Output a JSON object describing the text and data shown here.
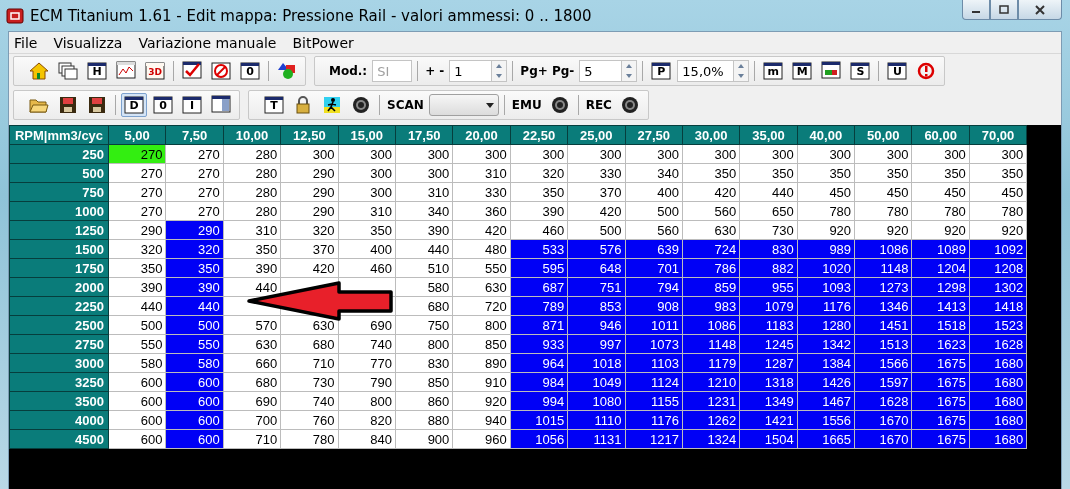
{
  "window": {
    "title": "ECM Titanium 1.61 - Edit mappa: Pressione Rail - valori ammessi: 0 .. 1800"
  },
  "menu": [
    "File",
    "Visualizza",
    "Variazione manuale",
    "BitPower"
  ],
  "toolbars": [
    {
      "groups": [
        {
          "items": [
            {
              "kind": "house",
              "pressed": false
            },
            {
              "kind": "windows",
              "pressed": false
            },
            {
              "kind": "letter",
              "glyph": "H",
              "pressed": false
            },
            {
              "kind": "chart",
              "pressed": false
            },
            {
              "kind": "redletter",
              "glyph": "3D",
              "pressed": false
            },
            {
              "kind": "sep"
            },
            {
              "kind": "check",
              "pressed": false
            },
            {
              "kind": "stop",
              "pressed": false
            },
            {
              "kind": "letter",
              "glyph": "0",
              "pressed": false
            },
            {
              "kind": "sep"
            },
            {
              "kind": "shapes",
              "pressed": false
            }
          ]
        },
        {
          "items": [
            {
              "kind": "label",
              "text": "Mod.:"
            },
            {
              "kind": "field",
              "value": "SI",
              "disabled": true
            },
            {
              "kind": "sep"
            },
            {
              "kind": "label",
              "text": "+ -"
            },
            {
              "kind": "spin",
              "value": "1"
            },
            {
              "kind": "sep"
            },
            {
              "kind": "label",
              "text": "Pg+ Pg-"
            },
            {
              "kind": "spin",
              "value": "5"
            },
            {
              "kind": "sep"
            },
            {
              "kind": "letter",
              "glyph": "P",
              "pressed": false
            },
            {
              "kind": "spin",
              "value": "15,0%"
            },
            {
              "kind": "sep"
            },
            {
              "kind": "letter",
              "glyph": "m",
              "pressed": false
            },
            {
              "kind": "letter",
              "glyph": "M",
              "pressed": false
            },
            {
              "kind": "bars",
              "pressed": false
            },
            {
              "kind": "letter",
              "glyph": "S",
              "pressed": false
            },
            {
              "kind": "sep"
            },
            {
              "kind": "letter",
              "glyph": "U",
              "pressed": false
            },
            {
              "kind": "alert",
              "pressed": false
            }
          ]
        }
      ]
    },
    {
      "groups": [
        {
          "items": [
            {
              "kind": "folder",
              "pressed": false
            },
            {
              "kind": "floppy",
              "pressed": false
            },
            {
              "kind": "floppy",
              "pressed": false
            },
            {
              "kind": "sep"
            },
            {
              "kind": "letter",
              "glyph": "D",
              "pressed": true
            },
            {
              "kind": "letter",
              "glyph": "0",
              "pressed": false
            },
            {
              "kind": "letter",
              "glyph": "I",
              "pressed": false
            },
            {
              "kind": "panel",
              "pressed": false
            }
          ]
        },
        {
          "items": [
            {
              "kind": "letter",
              "glyph": "T",
              "pressed": false
            },
            {
              "kind": "lock",
              "pressed": false
            },
            {
              "kind": "runner",
              "pressed": false
            },
            {
              "kind": "record",
              "pressed": false
            },
            {
              "kind": "sep"
            },
            {
              "kind": "label",
              "text": "SCAN"
            },
            {
              "kind": "combo"
            },
            {
              "kind": "sep"
            },
            {
              "kind": "label",
              "text": "EMU"
            },
            {
              "kind": "record",
              "pressed": false
            },
            {
              "kind": "sep"
            },
            {
              "kind": "label",
              "text": "REC"
            },
            {
              "kind": "record",
              "pressed": false
            }
          ]
        }
      ]
    }
  ],
  "table": {
    "corner": "RPM|mm3/cyc",
    "columns": [
      "5,00",
      "7,50",
      "10,00",
      "12,50",
      "15,00",
      "17,50",
      "20,00",
      "22,50",
      "25,00",
      "27,50",
      "30,00",
      "35,00",
      "40,00",
      "50,00",
      "60,00",
      "70,00"
    ],
    "rows": [
      {
        "rpm": "250",
        "cells": [
          {
            "text": "270",
            "selected": false,
            "focused": true
          },
          {
            "text": "270",
            "selected": false,
            "focused": false
          },
          {
            "text": "280",
            "selected": false,
            "focused": false
          },
          {
            "text": "300",
            "selected": false,
            "focused": false
          },
          {
            "text": "300",
            "selected": false,
            "focused": false
          },
          {
            "text": "300",
            "selected": false,
            "focused": false
          },
          {
            "text": "300",
            "selected": false,
            "focused": false
          },
          {
            "text": "300",
            "selected": false,
            "focused": false
          },
          {
            "text": "300",
            "selected": false,
            "focused": false
          },
          {
            "text": "300",
            "selected": false,
            "focused": false
          },
          {
            "text": "300",
            "selected": false,
            "focused": false
          },
          {
            "text": "300",
            "selected": false,
            "focused": false
          },
          {
            "text": "300",
            "selected": false,
            "focused": false
          },
          {
            "text": "300",
            "selected": false,
            "focused": false
          },
          {
            "text": "300",
            "selected": false,
            "focused": false
          },
          {
            "text": "300",
            "selected": false,
            "focused": false
          }
        ]
      },
      {
        "rpm": "500",
        "cells": [
          {
            "text": "270",
            "selected": false,
            "focused": false
          },
          {
            "text": "270",
            "selected": false,
            "focused": false
          },
          {
            "text": "280",
            "selected": false,
            "focused": false
          },
          {
            "text": "290",
            "selected": false,
            "focused": false
          },
          {
            "text": "300",
            "selected": false,
            "focused": false
          },
          {
            "text": "300",
            "selected": false,
            "focused": false
          },
          {
            "text": "310",
            "selected": false,
            "focused": false
          },
          {
            "text": "320",
            "selected": false,
            "focused": false
          },
          {
            "text": "330",
            "selected": false,
            "focused": false
          },
          {
            "text": "340",
            "selected": false,
            "focused": false
          },
          {
            "text": "350",
            "selected": false,
            "focused": false
          },
          {
            "text": "350",
            "selected": false,
            "focused": false
          },
          {
            "text": "350",
            "selected": false,
            "focused": false
          },
          {
            "text": "350",
            "selected": false,
            "focused": false
          },
          {
            "text": "350",
            "selected": false,
            "focused": false
          },
          {
            "text": "350",
            "selected": false,
            "focused": false
          }
        ]
      },
      {
        "rpm": "750",
        "cells": [
          {
            "text": "270",
            "selected": false,
            "focused": false
          },
          {
            "text": "270",
            "selected": false,
            "focused": false
          },
          {
            "text": "280",
            "selected": false,
            "focused": false
          },
          {
            "text": "290",
            "selected": false,
            "focused": false
          },
          {
            "text": "300",
            "selected": false,
            "focused": false
          },
          {
            "text": "310",
            "selected": false,
            "focused": false
          },
          {
            "text": "330",
            "selected": false,
            "focused": false
          },
          {
            "text": "350",
            "selected": false,
            "focused": false
          },
          {
            "text": "370",
            "selected": false,
            "focused": false
          },
          {
            "text": "400",
            "selected": false,
            "focused": false
          },
          {
            "text": "420",
            "selected": false,
            "focused": false
          },
          {
            "text": "440",
            "selected": false,
            "focused": false
          },
          {
            "text": "450",
            "selected": false,
            "focused": false
          },
          {
            "text": "450",
            "selected": false,
            "focused": false
          },
          {
            "text": "450",
            "selected": false,
            "focused": false
          },
          {
            "text": "450",
            "selected": false,
            "focused": false
          }
        ]
      },
      {
        "rpm": "1000",
        "cells": [
          {
            "text": "270",
            "selected": false,
            "focused": false
          },
          {
            "text": "270",
            "selected": false,
            "focused": false
          },
          {
            "text": "280",
            "selected": false,
            "focused": false
          },
          {
            "text": "290",
            "selected": false,
            "focused": false
          },
          {
            "text": "310",
            "selected": false,
            "focused": false
          },
          {
            "text": "340",
            "selected": false,
            "focused": false
          },
          {
            "text": "360",
            "selected": false,
            "focused": false
          },
          {
            "text": "390",
            "selected": false,
            "focused": false
          },
          {
            "text": "420",
            "selected": false,
            "focused": false
          },
          {
            "text": "500",
            "selected": false,
            "focused": false
          },
          {
            "text": "560",
            "selected": false,
            "focused": false
          },
          {
            "text": "650",
            "selected": false,
            "focused": false
          },
          {
            "text": "780",
            "selected": false,
            "focused": false
          },
          {
            "text": "780",
            "selected": false,
            "focused": false
          },
          {
            "text": "780",
            "selected": false,
            "focused": false
          },
          {
            "text": "780",
            "selected": false,
            "focused": false
          }
        ]
      },
      {
        "rpm": "1250",
        "cells": [
          {
            "text": "290",
            "selected": false,
            "focused": false
          },
          {
            "text": "290",
            "selected": true,
            "focused": false
          },
          {
            "text": "310",
            "selected": false,
            "focused": false
          },
          {
            "text": "320",
            "selected": false,
            "focused": false
          },
          {
            "text": "350",
            "selected": false,
            "focused": false
          },
          {
            "text": "390",
            "selected": false,
            "focused": false
          },
          {
            "text": "420",
            "selected": false,
            "focused": false
          },
          {
            "text": "460",
            "selected": false,
            "focused": false
          },
          {
            "text": "500",
            "selected": false,
            "focused": false
          },
          {
            "text": "560",
            "selected": false,
            "focused": false
          },
          {
            "text": "630",
            "selected": false,
            "focused": false
          },
          {
            "text": "730",
            "selected": false,
            "focused": false
          },
          {
            "text": "920",
            "selected": false,
            "focused": false
          },
          {
            "text": "920",
            "selected": false,
            "focused": false
          },
          {
            "text": "920",
            "selected": false,
            "focused": false
          },
          {
            "text": "920",
            "selected": false,
            "focused": false
          }
        ]
      },
      {
        "rpm": "1500",
        "cells": [
          {
            "text": "320",
            "selected": false,
            "focused": false
          },
          {
            "text": "320",
            "selected": true,
            "focused": false
          },
          {
            "text": "350",
            "selected": false,
            "focused": false
          },
          {
            "text": "370",
            "selected": false,
            "focused": false
          },
          {
            "text": "400",
            "selected": false,
            "focused": false
          },
          {
            "text": "440",
            "selected": false,
            "focused": false
          },
          {
            "text": "480",
            "selected": false,
            "focused": false
          },
          {
            "text": "533",
            "selected": true,
            "focused": false
          },
          {
            "text": "576",
            "selected": true,
            "focused": false
          },
          {
            "text": "639",
            "selected": true,
            "focused": false
          },
          {
            "text": "724",
            "selected": true,
            "focused": false
          },
          {
            "text": "830",
            "selected": true,
            "focused": false
          },
          {
            "text": "989",
            "selected": true,
            "focused": false
          },
          {
            "text": "1086",
            "selected": true,
            "focused": false
          },
          {
            "text": "1089",
            "selected": true,
            "focused": false
          },
          {
            "text": "1092",
            "selected": true,
            "focused": false
          }
        ]
      },
      {
        "rpm": "1750",
        "cells": [
          {
            "text": "350",
            "selected": false,
            "focused": false
          },
          {
            "text": "350",
            "selected": true,
            "focused": false
          },
          {
            "text": "390",
            "selected": false,
            "focused": false
          },
          {
            "text": "420",
            "selected": false,
            "focused": false
          },
          {
            "text": "460",
            "selected": false,
            "focused": false
          },
          {
            "text": "510",
            "selected": false,
            "focused": false
          },
          {
            "text": "550",
            "selected": false,
            "focused": false
          },
          {
            "text": "595",
            "selected": true,
            "focused": false
          },
          {
            "text": "648",
            "selected": true,
            "focused": false
          },
          {
            "text": "701",
            "selected": true,
            "focused": false
          },
          {
            "text": "786",
            "selected": true,
            "focused": false
          },
          {
            "text": "882",
            "selected": true,
            "focused": false
          },
          {
            "text": "1020",
            "selected": true,
            "focused": false
          },
          {
            "text": "1148",
            "selected": true,
            "focused": false
          },
          {
            "text": "1204",
            "selected": true,
            "focused": false
          },
          {
            "text": "1208",
            "selected": true,
            "focused": false
          }
        ]
      },
      {
        "rpm": "2000",
        "cells": [
          {
            "text": "390",
            "selected": false,
            "focused": false
          },
          {
            "text": "390",
            "selected": true,
            "focused": false
          },
          {
            "text": "440",
            "selected": false,
            "focused": false
          },
          {},
          {},
          {
            "text": "580",
            "selected": false,
            "focused": false
          },
          {
            "text": "630",
            "selected": false,
            "focused": false
          },
          {
            "text": "687",
            "selected": true,
            "focused": false
          },
          {
            "text": "751",
            "selected": true,
            "focused": false
          },
          {
            "text": "794",
            "selected": true,
            "focused": false
          },
          {
            "text": "859",
            "selected": true,
            "focused": false
          },
          {
            "text": "955",
            "selected": true,
            "focused": false
          },
          {
            "text": "1093",
            "selected": true,
            "focused": false
          },
          {
            "text": "1273",
            "selected": true,
            "focused": false
          },
          {
            "text": "1298",
            "selected": true,
            "focused": false
          },
          {
            "text": "1302",
            "selected": true,
            "focused": false
          }
        ]
      },
      {
        "rpm": "2250",
        "cells": [
          {
            "text": "440",
            "selected": false,
            "focused": false
          },
          {
            "text": "440",
            "selected": true,
            "focused": false
          },
          {},
          {},
          {},
          {
            "text": "680",
            "selected": false,
            "focused": false
          },
          {
            "text": "720",
            "selected": false,
            "focused": false
          },
          {
            "text": "789",
            "selected": true,
            "focused": false
          },
          {
            "text": "853",
            "selected": true,
            "focused": false
          },
          {
            "text": "908",
            "selected": true,
            "focused": false
          },
          {
            "text": "983",
            "selected": true,
            "focused": false
          },
          {
            "text": "1079",
            "selected": true,
            "focused": false
          },
          {
            "text": "1176",
            "selected": true,
            "focused": false
          },
          {
            "text": "1346",
            "selected": true,
            "focused": false
          },
          {
            "text": "1413",
            "selected": true,
            "focused": false
          },
          {
            "text": "1418",
            "selected": true,
            "focused": false
          }
        ]
      },
      {
        "rpm": "2500",
        "cells": [
          {
            "text": "500",
            "selected": false,
            "focused": false
          },
          {
            "text": "500",
            "selected": true,
            "focused": false
          },
          {
            "text": "570",
            "selected": false,
            "focused": false
          },
          {
            "text": "630",
            "selected": false,
            "focused": false
          },
          {
            "text": "690",
            "selected": false,
            "focused": false
          },
          {
            "text": "750",
            "selected": false,
            "focused": false
          },
          {
            "text": "800",
            "selected": false,
            "focused": false
          },
          {
            "text": "871",
            "selected": true,
            "focused": false
          },
          {
            "text": "946",
            "selected": true,
            "focused": false
          },
          {
            "text": "1011",
            "selected": true,
            "focused": false
          },
          {
            "text": "1086",
            "selected": true,
            "focused": false
          },
          {
            "text": "1183",
            "selected": true,
            "focused": false
          },
          {
            "text": "1280",
            "selected": true,
            "focused": false
          },
          {
            "text": "1451",
            "selected": true,
            "focused": false
          },
          {
            "text": "1518",
            "selected": true,
            "focused": false
          },
          {
            "text": "1523",
            "selected": true,
            "focused": false
          }
        ]
      },
      {
        "rpm": "2750",
        "cells": [
          {
            "text": "550",
            "selected": false,
            "focused": false
          },
          {
            "text": "550",
            "selected": true,
            "focused": false
          },
          {
            "text": "630",
            "selected": false,
            "focused": false
          },
          {
            "text": "680",
            "selected": false,
            "focused": false
          },
          {
            "text": "740",
            "selected": false,
            "focused": false
          },
          {
            "text": "800",
            "selected": false,
            "focused": false
          },
          {
            "text": "850",
            "selected": false,
            "focused": false
          },
          {
            "text": "933",
            "selected": true,
            "focused": false
          },
          {
            "text": "997",
            "selected": true,
            "focused": false
          },
          {
            "text": "1073",
            "selected": true,
            "focused": false
          },
          {
            "text": "1148",
            "selected": true,
            "focused": false
          },
          {
            "text": "1245",
            "selected": true,
            "focused": false
          },
          {
            "text": "1342",
            "selected": true,
            "focused": false
          },
          {
            "text": "1513",
            "selected": true,
            "focused": false
          },
          {
            "text": "1623",
            "selected": true,
            "focused": false
          },
          {
            "text": "1628",
            "selected": true,
            "focused": false
          }
        ]
      },
      {
        "rpm": "3000",
        "cells": [
          {
            "text": "580",
            "selected": false,
            "focused": false
          },
          {
            "text": "580",
            "selected": true,
            "focused": false
          },
          {
            "text": "660",
            "selected": false,
            "focused": false
          },
          {
            "text": "710",
            "selected": false,
            "focused": false
          },
          {
            "text": "770",
            "selected": false,
            "focused": false
          },
          {
            "text": "830",
            "selected": false,
            "focused": false
          },
          {
            "text": "890",
            "selected": false,
            "focused": false
          },
          {
            "text": "964",
            "selected": true,
            "focused": false
          },
          {
            "text": "1018",
            "selected": true,
            "focused": false
          },
          {
            "text": "1103",
            "selected": true,
            "focused": false
          },
          {
            "text": "1179",
            "selected": true,
            "focused": false
          },
          {
            "text": "1287",
            "selected": true,
            "focused": false
          },
          {
            "text": "1384",
            "selected": true,
            "focused": false
          },
          {
            "text": "1566",
            "selected": true,
            "focused": false
          },
          {
            "text": "1675",
            "selected": true,
            "focused": false
          },
          {
            "text": "1680",
            "selected": true,
            "focused": false
          }
        ]
      },
      {
        "rpm": "3250",
        "cells": [
          {
            "text": "600",
            "selected": false,
            "focused": false
          },
          {
            "text": "600",
            "selected": true,
            "focused": false
          },
          {
            "text": "680",
            "selected": false,
            "focused": false
          },
          {
            "text": "730",
            "selected": false,
            "focused": false
          },
          {
            "text": "790",
            "selected": false,
            "focused": false
          },
          {
            "text": "850",
            "selected": false,
            "focused": false
          },
          {
            "text": "910",
            "selected": false,
            "focused": false
          },
          {
            "text": "984",
            "selected": true,
            "focused": false
          },
          {
            "text": "1049",
            "selected": true,
            "focused": false
          },
          {
            "text": "1124",
            "selected": true,
            "focused": false
          },
          {
            "text": "1210",
            "selected": true,
            "focused": false
          },
          {
            "text": "1318",
            "selected": true,
            "focused": false
          },
          {
            "text": "1426",
            "selected": true,
            "focused": false
          },
          {
            "text": "1597",
            "selected": true,
            "focused": false
          },
          {
            "text": "1675",
            "selected": true,
            "focused": false
          },
          {
            "text": "1680",
            "selected": true,
            "focused": false
          }
        ]
      },
      {
        "rpm": "3500",
        "cells": [
          {
            "text": "600",
            "selected": false,
            "focused": false
          },
          {
            "text": "600",
            "selected": true,
            "focused": false
          },
          {
            "text": "690",
            "selected": false,
            "focused": false
          },
          {
            "text": "740",
            "selected": false,
            "focused": false
          },
          {
            "text": "800",
            "selected": false,
            "focused": false
          },
          {
            "text": "860",
            "selected": false,
            "focused": false
          },
          {
            "text": "920",
            "selected": false,
            "focused": false
          },
          {
            "text": "994",
            "selected": true,
            "focused": false
          },
          {
            "text": "1080",
            "selected": true,
            "focused": false
          },
          {
            "text": "1155",
            "selected": true,
            "focused": false
          },
          {
            "text": "1231",
            "selected": true,
            "focused": false
          },
          {
            "text": "1349",
            "selected": true,
            "focused": false
          },
          {
            "text": "1467",
            "selected": true,
            "focused": false
          },
          {
            "text": "1628",
            "selected": true,
            "focused": false
          },
          {
            "text": "1675",
            "selected": true,
            "focused": false
          },
          {
            "text": "1680",
            "selected": true,
            "focused": false
          }
        ]
      },
      {
        "rpm": "4000",
        "cells": [
          {
            "text": "600",
            "selected": false,
            "focused": false
          },
          {
            "text": "600",
            "selected": true,
            "focused": false
          },
          {
            "text": "700",
            "selected": false,
            "focused": false
          },
          {
            "text": "760",
            "selected": false,
            "focused": false
          },
          {
            "text": "820",
            "selected": false,
            "focused": false
          },
          {
            "text": "880",
            "selected": false,
            "focused": false
          },
          {
            "text": "940",
            "selected": false,
            "focused": false
          },
          {
            "text": "1015",
            "selected": true,
            "focused": false
          },
          {
            "text": "1110",
            "selected": true,
            "focused": false
          },
          {
            "text": "1176",
            "selected": true,
            "focused": false
          },
          {
            "text": "1262",
            "selected": true,
            "focused": false
          },
          {
            "text": "1421",
            "selected": true,
            "focused": false
          },
          {
            "text": "1556",
            "selected": true,
            "focused": false
          },
          {
            "text": "1670",
            "selected": true,
            "focused": false
          },
          {
            "text": "1675",
            "selected": true,
            "focused": false
          },
          {
            "text": "1680",
            "selected": true,
            "focused": false
          }
        ]
      },
      {
        "rpm": "4500",
        "cells": [
          {
            "text": "600",
            "selected": false,
            "focused": false
          },
          {
            "text": "600",
            "selected": true,
            "focused": false
          },
          {
            "text": "710",
            "selected": false,
            "focused": false
          },
          {
            "text": "780",
            "selected": false,
            "focused": false
          },
          {
            "text": "840",
            "selected": false,
            "focused": false
          },
          {
            "text": "900",
            "selected": false,
            "focused": false
          },
          {
            "text": "960",
            "selected": false,
            "focused": false
          },
          {
            "text": "1056",
            "selected": true,
            "focused": false
          },
          {
            "text": "1131",
            "selected": true,
            "focused": false
          },
          {
            "text": "1217",
            "selected": true,
            "focused": false
          },
          {
            "text": "1324",
            "selected": true,
            "focused": false
          },
          {
            "text": "1504",
            "selected": true,
            "focused": false
          },
          {
            "text": "1665",
            "selected": true,
            "focused": false
          },
          {
            "text": "1670",
            "selected": true,
            "focused": false
          },
          {
            "text": "1675",
            "selected": true,
            "focused": false
          },
          {
            "text": "1680",
            "selected": true,
            "focused": false
          }
        ]
      }
    ]
  }
}
